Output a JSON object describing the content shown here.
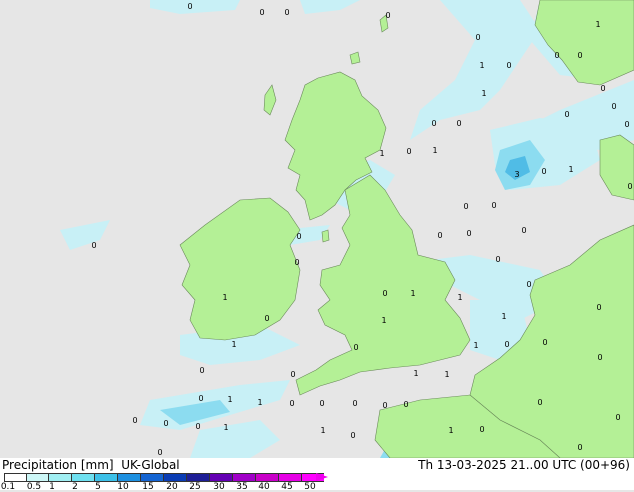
{
  "title": {
    "product": "Precipitation [mm]",
    "model": "UK-Global",
    "datetime": "Th 13-03-2025 21..00 UTC (00+96)"
  },
  "legend": {
    "labels": [
      "0.1",
      "0.5",
      "1",
      "2",
      "5",
      "10",
      "15",
      "20",
      "25",
      "30",
      "35",
      "40",
      "45",
      "50"
    ],
    "colors": [
      "#ffffff",
      "#cdf7f7",
      "#a0eef2",
      "#6ee0f0",
      "#3cc0e8",
      "#1e90e0",
      "#1464d2",
      "#0a3cb4",
      "#1e1e96",
      "#6400b4",
      "#a000c8",
      "#c800c8",
      "#e600e6",
      "#ff00ff"
    ]
  },
  "colors": {
    "sea": "#e6e6e6",
    "land": "#b4f096",
    "precip_light": "#c8f0f6",
    "precip_medium": "#8cdcf0",
    "precip_heavy": "#50bce6"
  },
  "values": [
    {
      "t": "0"
    },
    {
      "t": "0"
    },
    {
      "t": "0"
    },
    {
      "t": "0"
    },
    {
      "t": "0"
    },
    {
      "t": "1"
    },
    {
      "t": "0"
    },
    {
      "t": "0"
    },
    {
      "t": "1"
    },
    {
      "t": "0"
    },
    {
      "t": "1"
    },
    {
      "t": "0"
    },
    {
      "t": "0"
    },
    {
      "t": "0"
    },
    {
      "t": "0"
    },
    {
      "t": "0"
    },
    {
      "t": "0"
    },
    {
      "t": "1"
    },
    {
      "t": "3"
    },
    {
      "t": "0"
    },
    {
      "t": "1"
    },
    {
      "t": "1"
    },
    {
      "t": "0"
    },
    {
      "t": "0"
    },
    {
      "t": "0"
    },
    {
      "t": "0"
    },
    {
      "t": "0"
    },
    {
      "t": "0"
    },
    {
      "t": "0"
    },
    {
      "t": "0"
    },
    {
      "t": "0"
    },
    {
      "t": "0"
    },
    {
      "t": "0"
    },
    {
      "t": "0"
    },
    {
      "t": "0"
    },
    {
      "t": "1"
    },
    {
      "t": "1"
    },
    {
      "t": "0"
    },
    {
      "t": "0"
    },
    {
      "t": "1"
    },
    {
      "t": "1"
    },
    {
      "t": "0"
    },
    {
      "t": "1"
    },
    {
      "t": "0"
    },
    {
      "t": "0"
    },
    {
      "t": "0"
    },
    {
      "t": "1"
    },
    {
      "t": "1"
    },
    {
      "t": "0"
    },
    {
      "t": "0"
    },
    {
      "t": "1"
    },
    {
      "t": "1"
    },
    {
      "t": "0"
    },
    {
      "t": "0"
    },
    {
      "t": "0"
    },
    {
      "t": "0"
    },
    {
      "t": "0"
    },
    {
      "t": "0"
    },
    {
      "t": "0"
    },
    {
      "t": "1"
    },
    {
      "t": "1"
    },
    {
      "t": "1"
    },
    {
      "t": "0"
    },
    {
      "t": "0"
    },
    {
      "t": "0"
    },
    {
      "t": "0"
    },
    {
      "t": "0"
    },
    {
      "t": "0"
    },
    {
      "t": "0"
    },
    {
      "t": "0"
    },
    {
      "t": "1"
    },
    {
      "t": "1"
    }
  ]
}
